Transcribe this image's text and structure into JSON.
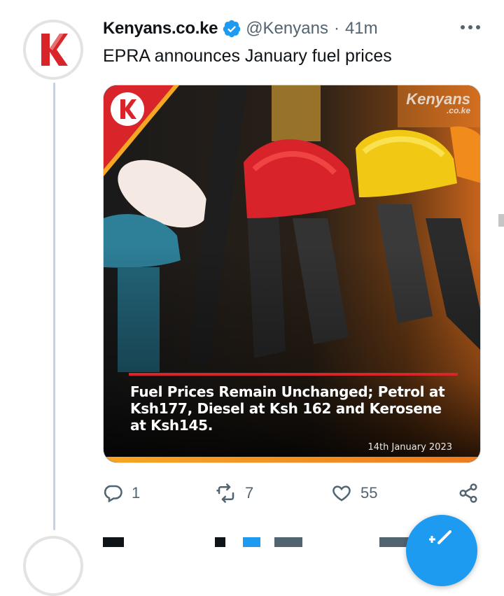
{
  "tweet": {
    "display_name": "Kenyans.co.ke",
    "handle": "@Kenyans",
    "separator": "·",
    "time": "41m",
    "text": "EPRA announces January fuel prices",
    "avatar_icon": "kenyans-k-logo-icon",
    "verified_icon": "verified-badge-icon",
    "more_icon": "more-dots-icon"
  },
  "media": {
    "brand_main": "Kenyans",
    "brand_sub": ".co.ke",
    "headline": "Fuel Prices Remain Unchanged; Petrol at Ksh177, Diesel at Ksh 162 and Kerosene at Ksh145.",
    "date": "14th January 2023",
    "accent_color": "#d9252a"
  },
  "actions": {
    "reply_count": "1",
    "retweet_count": "7",
    "like_count": "55"
  },
  "colors": {
    "text_primary": "#0f1419",
    "text_secondary": "#536471",
    "twitter_blue": "#1d9bf0",
    "brand_red": "#d9252a"
  }
}
